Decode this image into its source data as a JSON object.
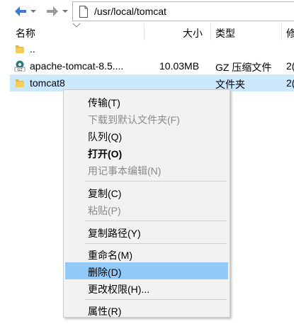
{
  "toolbar": {
    "path": "/usr/local/tomcat"
  },
  "columns": {
    "name": "名称",
    "size": "大小",
    "type": "类型",
    "modified": "修"
  },
  "files": [
    {
      "name": "..",
      "size": "",
      "type": "",
      "modified": "",
      "icon": "folder-icon"
    },
    {
      "name": "apache-tomcat-8.5....",
      "size": "10.03MB",
      "type": "GZ 压缩文件",
      "modified": "2(",
      "icon": "gz-archive-icon"
    },
    {
      "name": "tomcat8",
      "size": "",
      "type": "文件夹",
      "modified": "2(",
      "icon": "folder-icon"
    }
  ],
  "context_menu": {
    "transfer": "传输(T)",
    "download_default": "下载到默认文件夹(F)",
    "queue": "队列(Q)",
    "open": "打开(O)",
    "edit_notepad": "用记事本编辑(N)",
    "copy": "复制(C)",
    "paste": "粘贴(P)",
    "copy_path": "复制路径(Y)",
    "rename": "重命名(M)",
    "delete": "删除(D)",
    "permissions": "更改权限(H)...",
    "properties": "属性(R)"
  },
  "colors": {
    "selected_row": "#cce8ff",
    "menu_hover": "#91c9f7",
    "archive_teal": "#2e7a78"
  }
}
